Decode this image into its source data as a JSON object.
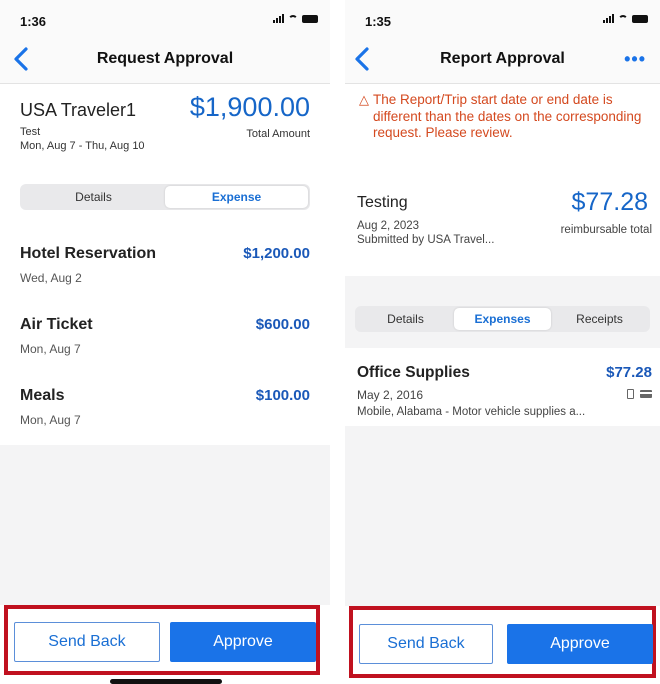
{
  "left": {
    "status": {
      "time": "1:36"
    },
    "nav": {
      "title": "Request Approval"
    },
    "header": {
      "traveler": "USA Traveler1",
      "total": "$1,900.00",
      "report_name": "Test",
      "total_label": "Total Amount",
      "dates": "Mon, Aug 7 - Thu, Aug 10"
    },
    "tabs": [
      {
        "label": "Details",
        "active": false
      },
      {
        "label": "Expense",
        "active": true
      }
    ],
    "expenses": [
      {
        "name": "Hotel Reservation",
        "amount": "$1,200.00",
        "date": "Wed, Aug 2"
      },
      {
        "name": "Air Ticket",
        "amount": "$600.00",
        "date": "Mon, Aug 7"
      },
      {
        "name": "Meals",
        "amount": "$100.00",
        "date": "Mon, Aug 7"
      }
    ],
    "actions": {
      "send_back": "Send Back",
      "approve": "Approve"
    }
  },
  "right": {
    "status": {
      "time": "1:35"
    },
    "nav": {
      "title": "Report Approval",
      "more": "•••"
    },
    "warning": {
      "icon": "warning-triangle-icon",
      "text": "The Report/Trip start date or end date is different than the dates on the corresponding request. Please review."
    },
    "header": {
      "title": "Testing",
      "total": "$77.28",
      "date": "Aug 2, 2023",
      "submitted": "Submitted by USA Travel...",
      "total_label": "reimbursable total"
    },
    "tabs": [
      {
        "label": "Details",
        "active": false
      },
      {
        "label": "Expenses",
        "active": true
      },
      {
        "label": "Receipts",
        "active": false
      }
    ],
    "expense": {
      "name": "Office Supplies",
      "amount": "$77.28",
      "date": "May 2, 2016",
      "description": "Mobile, Alabama - Motor vehicle supplies a..."
    },
    "actions": {
      "send_back": "Send Back",
      "approve": "Approve"
    }
  },
  "colors": {
    "accent_blue": "#1a73e8",
    "amount_blue": "#1666c8",
    "warning_orange": "#d4491f",
    "highlight_red": "#c0111f"
  }
}
